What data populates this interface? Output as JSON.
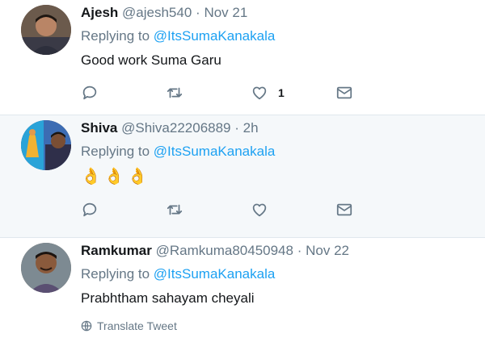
{
  "tweets": [
    {
      "name": "Ajesh",
      "handle": "@ajesh540",
      "separator": "·",
      "time": "Nov 21",
      "replying_prefix": "Replying to",
      "replying_to": "@ItsSumaKanakala",
      "text": "Good work Suma Garu",
      "like_count": "1",
      "avatar_bg": "#6b5a4c"
    },
    {
      "name": "Shiva",
      "handle": "@Shiva22206889",
      "separator": "·",
      "time": "2h",
      "replying_prefix": "Replying to",
      "replying_to": "@ItsSumaKanakala",
      "text": "👌👌👌",
      "like_count": "",
      "avatar_bg": "#3c6cb3"
    },
    {
      "name": "Ramkumar",
      "handle": "@Ramkuma80450948",
      "separator": "·",
      "time": "Nov 22",
      "replying_prefix": "Replying to",
      "replying_to": "@ItsSumaKanakala",
      "text": "Prabhtham sahayam cheyali",
      "translate_label": "Translate Tweet",
      "avatar_bg": "#7d8a92"
    }
  ],
  "colors": {
    "link": "#1da1f2",
    "muted": "#657786",
    "highlight_bg": "#f5f8fa",
    "divider": "#e1e8ed"
  },
  "icons": [
    "reply-icon",
    "retweet-icon",
    "like-icon",
    "direct-message-icon",
    "globe-icon",
    "ok-hand-emoji"
  ]
}
